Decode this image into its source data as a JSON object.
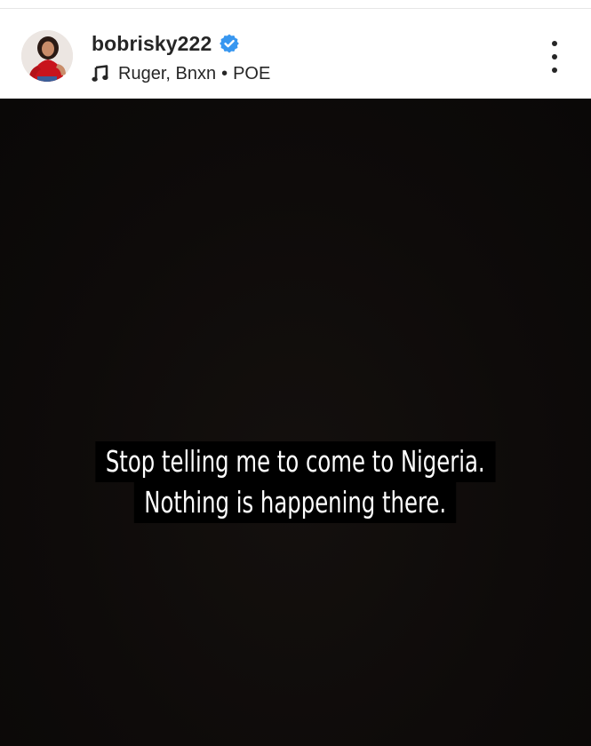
{
  "post_header": {
    "username": "bobrisky222",
    "verified": true,
    "avatar_icon": "profile-photo-avatar",
    "music": {
      "icon": "music-note-icon",
      "artists": "Ruger, Bnxn",
      "separator": "•",
      "song": "POE"
    },
    "menu_icon": "more-options-icon"
  },
  "colors": {
    "verified_badge": "#3897f0",
    "story_background": "#0e0b0a",
    "caption_background": "#000000",
    "caption_text": "#ffffff"
  },
  "story": {
    "caption_lines": [
      "Stop telling me to come to Nigeria.",
      "Nothing is happening there."
    ]
  }
}
